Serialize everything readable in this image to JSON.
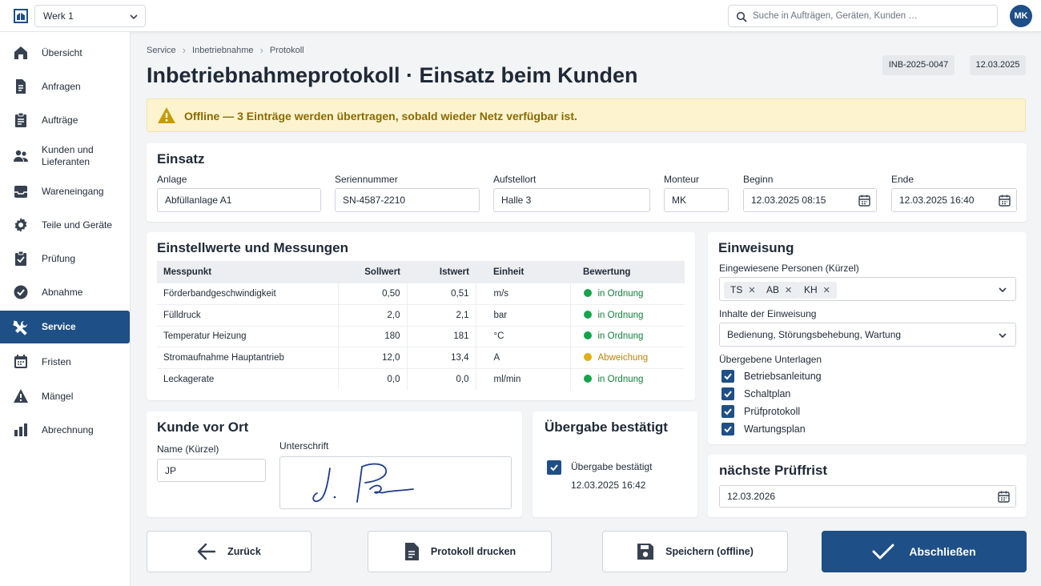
{
  "header": {
    "plant_select": "Werk 1",
    "search_placeholder": "Suche in Aufträgen, Geräten, Kunden …",
    "avatar": "MK"
  },
  "sidebar": {
    "items": [
      {
        "label": "Übersicht",
        "icon": "home-icon"
      },
      {
        "label": "Anfragen",
        "icon": "document-icon"
      },
      {
        "label": "Aufträge",
        "icon": "clipboard-icon"
      },
      {
        "label": "Kunden und Lieferanten",
        "icon": "people-icon"
      },
      {
        "label": "Wareneingang",
        "icon": "inbox-icon"
      },
      {
        "label": "Teile und Geräte",
        "icon": "gear-icon"
      },
      {
        "label": "Prüfung",
        "icon": "clipboard-check-icon"
      },
      {
        "label": "Abnahme",
        "icon": "check-circle-icon"
      },
      {
        "label": "Service",
        "icon": "wrench-icon",
        "active": true
      },
      {
        "label": "Fristen",
        "icon": "calendar-icon"
      },
      {
        "label": "Mängel",
        "icon": "warning-icon"
      },
      {
        "label": "Abrechnung",
        "icon": "bar-chart-icon"
      }
    ]
  },
  "breadcrumb": [
    "Service",
    "Inbetriebnahme",
    "Protokoll"
  ],
  "page": {
    "title": "Inbetriebnahmeprotokoll · Einsatz beim Kunden",
    "protocol_id": "INB-2025-0047",
    "date": "12.03.2025"
  },
  "offline_banner": "Offline — 3 Einträge werden übertragen, sobald wieder Netz verfügbar ist.",
  "einsatz": {
    "title": "Einsatz",
    "anlage_label": "Anlage",
    "anlage": "Abfüllanlage A1",
    "serial_label": "Seriennummer",
    "serial": "SN-4587-2210",
    "location_label": "Aufstellort",
    "location": "Halle 3",
    "monteur_label": "Monteur",
    "monteur": "MK",
    "start_label": "Beginn",
    "start": "12.03.2025 08:15",
    "end_label": "Ende",
    "end": "12.03.2025 16:40"
  },
  "measurements": {
    "title": "Einstellwerte und Messungen",
    "columns": [
      "Messpunkt",
      "Sollwert",
      "Istwert",
      "Einheit",
      "Bewertung"
    ],
    "rows": [
      {
        "point": "Förderbandgeschwindigkeit",
        "target": "0,50",
        "actual": "0,51",
        "unit": "m/s",
        "rating": "in Ordnung",
        "status": "ok"
      },
      {
        "point": "Fülldruck",
        "target": "2,0",
        "actual": "2,1",
        "unit": "bar",
        "rating": "in Ordnung",
        "status": "ok"
      },
      {
        "point": "Temperatur Heizung",
        "target": "180",
        "actual": "181",
        "unit": "°C",
        "rating": "in Ordnung",
        "status": "ok"
      },
      {
        "point": "Stromaufnahme Hauptantrieb",
        "target": "12,0",
        "actual": "13,4",
        "unit": "A",
        "rating": "Abweichung",
        "status": "warn"
      },
      {
        "point": "Leckagerate",
        "target": "0,0",
        "actual": "0,0",
        "unit": "ml/min",
        "rating": "in Ordnung",
        "status": "ok"
      }
    ],
    "colors": {
      "ok": "#16a34a",
      "warn": "#e0b011"
    }
  },
  "einweisung": {
    "title": "Einweisung",
    "persons_label": "Eingewiesene Personen (Kürzel)",
    "persons": [
      "TS",
      "AB",
      "KH"
    ],
    "contents_label": "Inhalte der Einweisung",
    "contents": "Bedienung, Störungsbehebung, Wartung",
    "docs_label": "Übergebene Unterlagen",
    "docs": [
      "Betriebsanleitung",
      "Schaltplan",
      "Prüfprotokoll",
      "Wartungsplan"
    ]
  },
  "customer": {
    "title": "Kunde vor Ort",
    "name_label": "Name (Kürzel)",
    "name": "JP",
    "signature_label": "Unterschrift"
  },
  "handover": {
    "title": "Übergabe bestätigt",
    "checkbox_label": "Übergabe bestätigt",
    "timestamp": "12.03.2025 16:42"
  },
  "next_inspection": {
    "title": "nächste Prüffrist",
    "date": "12.03.2026"
  },
  "actions": {
    "back": "Zurück",
    "print": "Protokoll drucken",
    "save": "Speichern (offline)",
    "finish": "Abschließen"
  },
  "colors": {
    "primary": "#1e4f86",
    "banner_bg": "#fdf4cf",
    "banner_text": "#8a6a00"
  }
}
